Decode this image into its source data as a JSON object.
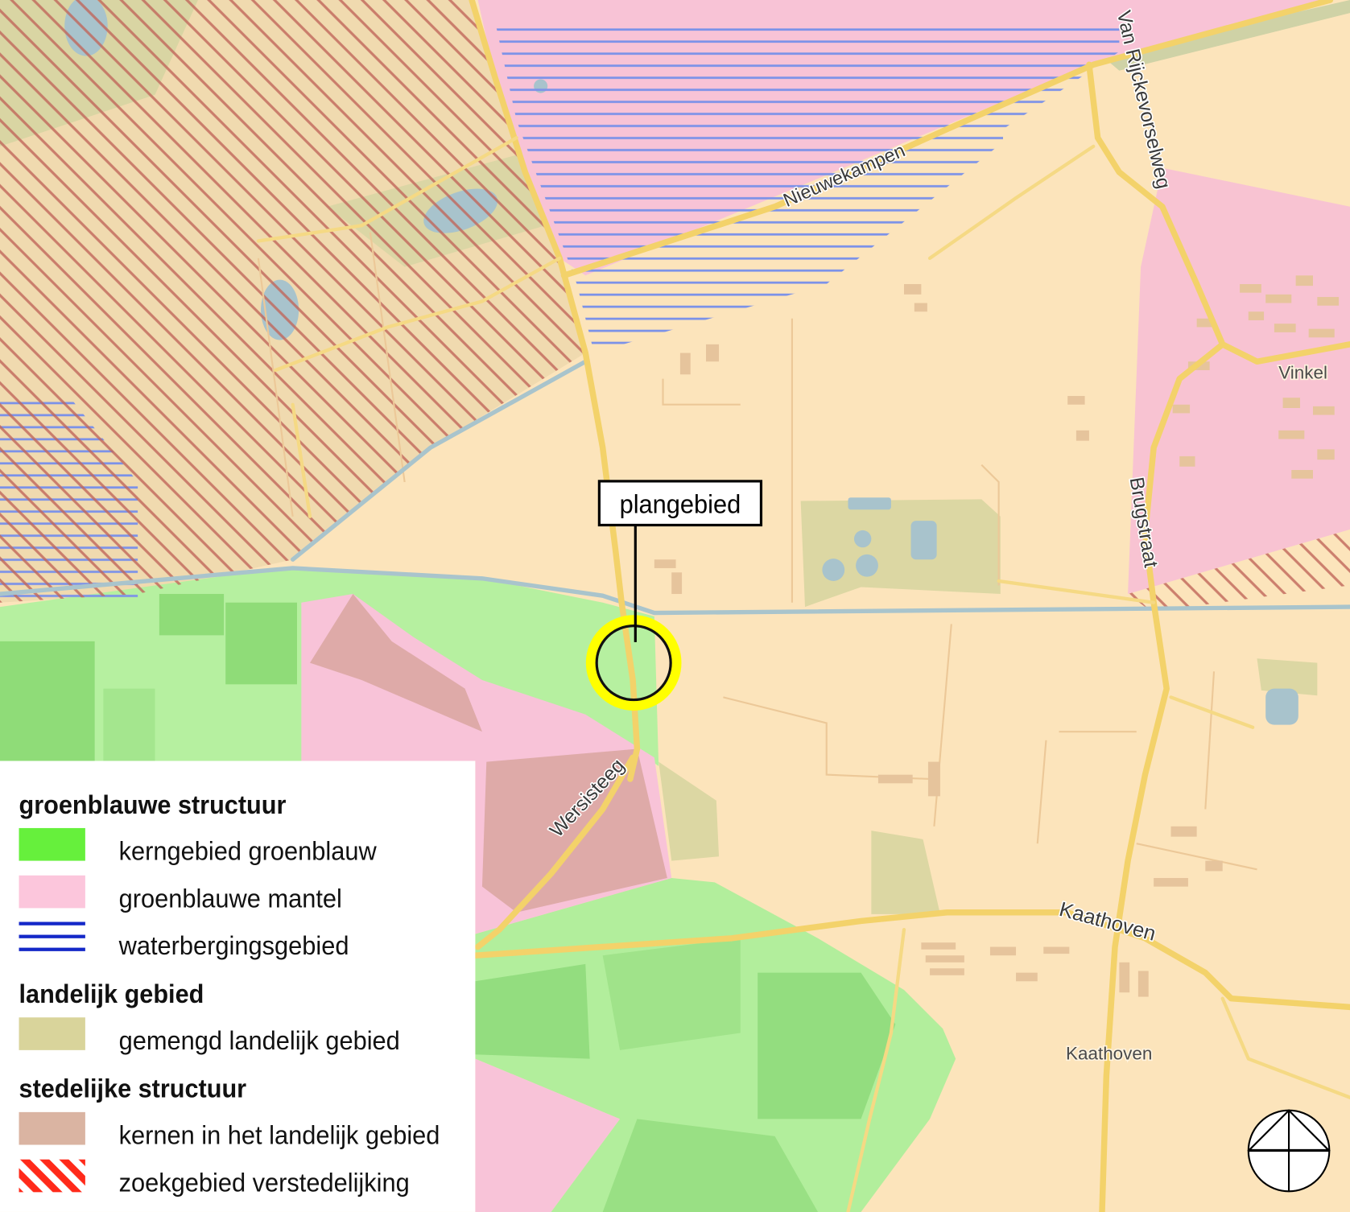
{
  "map": {
    "labels": {
      "road_van_rijckevorselweg": "Van Rijckevorselweg",
      "road_nieuwekampen": "Nieuwekampen",
      "place_vinkel": "Vinkel",
      "road_brugstraat": "Brugstraat",
      "road_wersisteeg": "Wersisteeg",
      "road_kaathoven": "Kaathoven",
      "place_kaathoven": "Kaathoven"
    },
    "callout": {
      "label": "plangebied",
      "marker_color": "#ffff00"
    }
  },
  "icons": {
    "north_arrow": "north-arrow-icon"
  },
  "legend": {
    "sections": [
      {
        "title": "groenblauwe structuur",
        "items": [
          {
            "label": "kerngebied groenblauw",
            "color": "#66f03c"
          },
          {
            "label": "groenblauwe mantel",
            "color": "#fcc6dc"
          },
          {
            "label": "waterbergingsgebied",
            "color": "#1428c8"
          }
        ]
      },
      {
        "title": "landelijk gebied",
        "items": [
          {
            "label": "gemengd landelijk gebied",
            "color": "#d9d49b"
          }
        ]
      },
      {
        "title": "stedelijke structuur",
        "items": [
          {
            "label": "kernen in het landelijk gebied",
            "color": "#dab4a2"
          },
          {
            "label": "zoekgebied verstedelijking",
            "color": "#ff2a1a"
          }
        ]
      }
    ]
  }
}
